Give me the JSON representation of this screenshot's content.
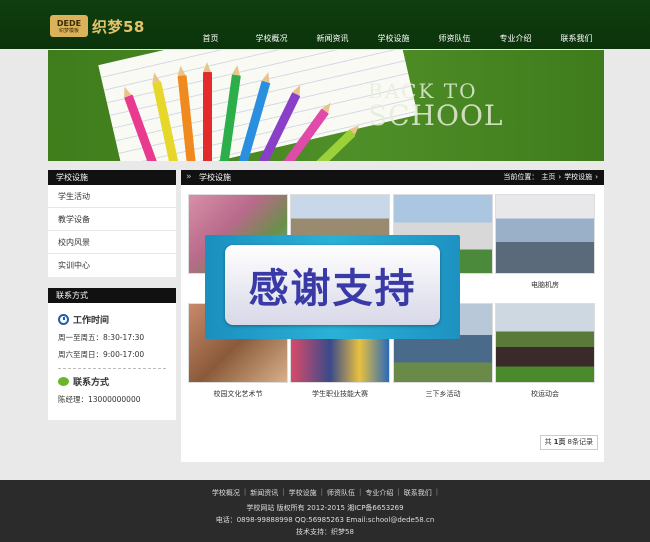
{
  "header": {
    "logo_badge": "DEDE",
    "logo_badge_sub": "织梦模板",
    "logo_text": "织梦58",
    "nav": [
      "首页",
      "学校概况",
      "新闻资讯",
      "学校设施",
      "师资队伍",
      "专业介绍",
      "联系我们"
    ]
  },
  "banner": {
    "line1": "BACK TO",
    "line2": "SCHOOL"
  },
  "sidebar": {
    "facilities_title": "学校设施",
    "items": [
      "学生活动",
      "教学设备",
      "校内风景",
      "实训中心"
    ],
    "contact_title": "联系方式",
    "work_time_title": "工作时间",
    "work_time_lines": [
      "周一至周五：8:30-17:30",
      "周六至周日：9:00-17:00"
    ],
    "contact_sub_title": "联系方式",
    "manager": "陈经理：13000000000"
  },
  "main": {
    "title": "学校设施",
    "breadcrumb_label": "当前位置：",
    "breadcrumb": [
      "主页",
      "学校设施"
    ],
    "captions": [
      "电脑机房",
      "校园文化艺术节",
      "学生职业技能大赛",
      "三下乡活动",
      "校运动会"
    ],
    "pager": {
      "prefix": "共",
      "pages": "1页",
      "records": "8条记录"
    }
  },
  "overlay": {
    "text": "感谢支持"
  },
  "footer": {
    "links": [
      "学校概况",
      "新闻资讯",
      "学校设施",
      "师资队伍",
      "专业介绍",
      "联系我们"
    ],
    "copyright": "学校网站 版权所有 2012-2015 湘ICP备6653269",
    "contact": "电话：0898-99888998 QQ:56985263 Email:school@dede58.cn",
    "support": "技术支持：织梦58"
  },
  "colors": {
    "header_bg": "#0f3e0f",
    "banner_green": "#4f8f28",
    "section_head": "#111111",
    "footer_bg": "#2b2b2b",
    "overlay_blue": "#2ab1d6",
    "overlay_text": "#3a3aa7"
  },
  "icons": [
    "clock-icon",
    "chat-icon",
    "double-arrow-icon",
    "chevron-right-icon"
  ]
}
